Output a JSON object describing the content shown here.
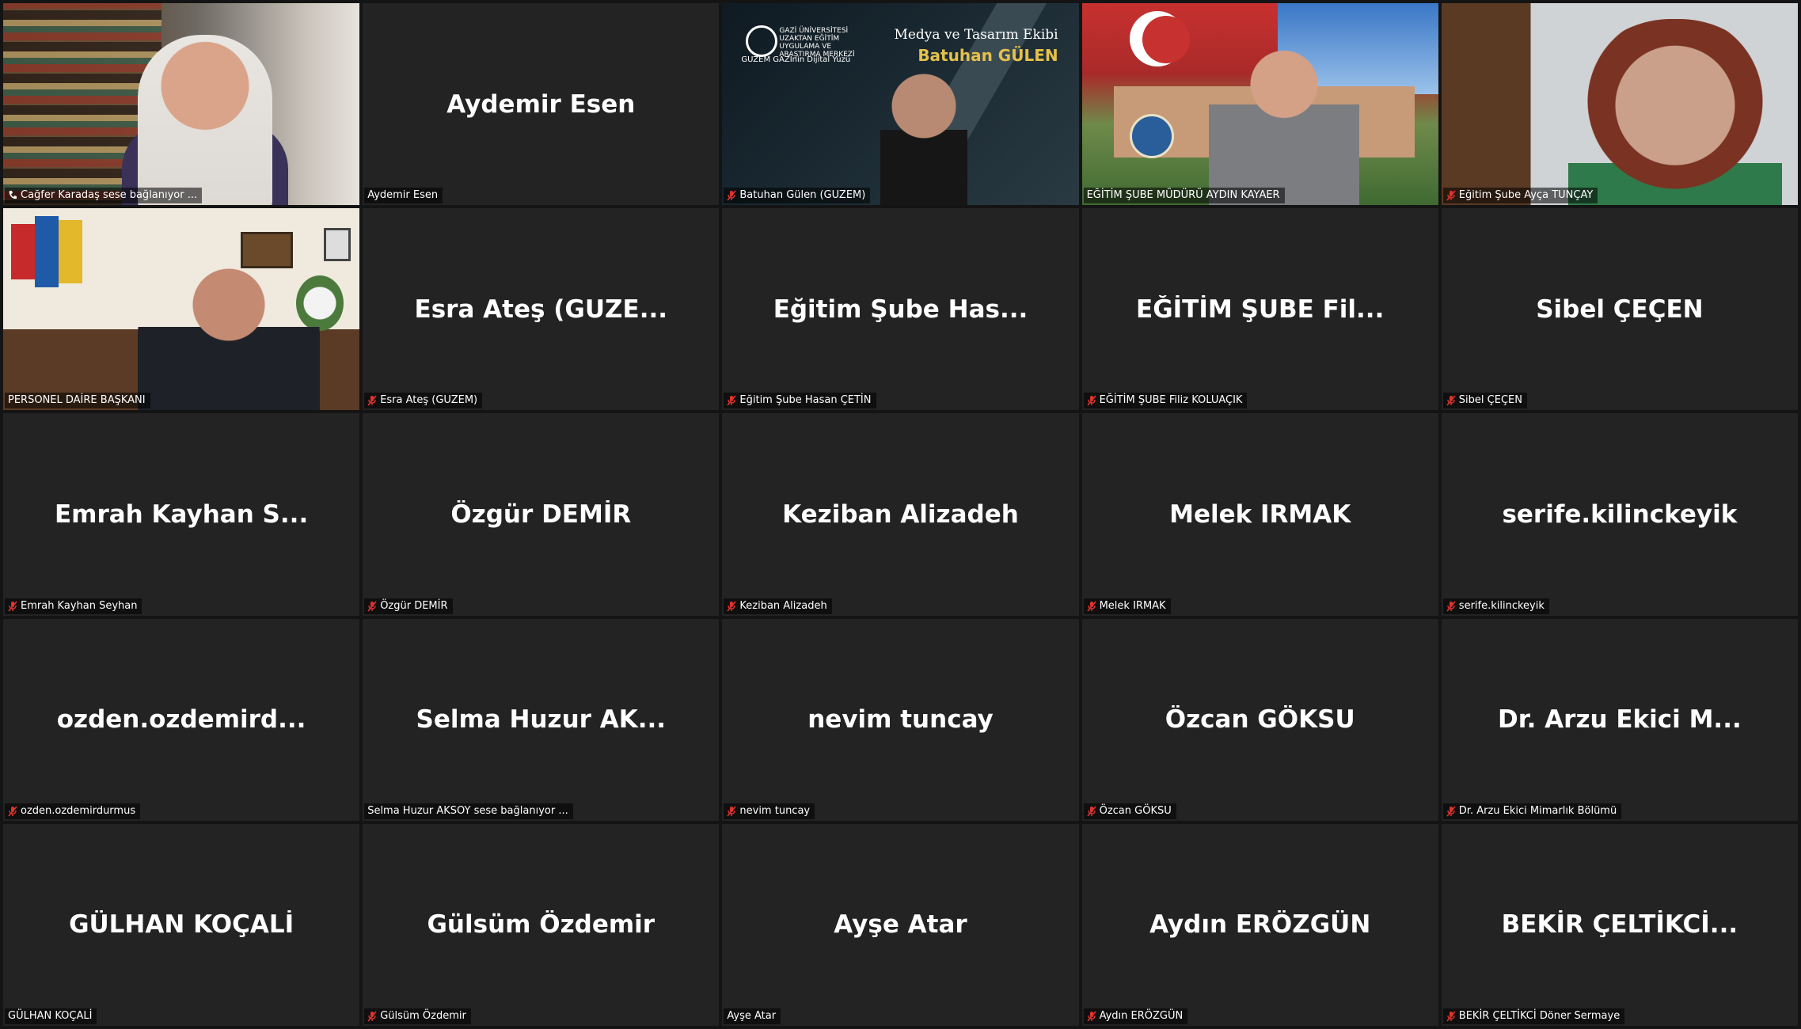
{
  "tiles": [
    {
      "id": "t1",
      "display_name": "",
      "label": "Cağfer Karadaş sese bağlanıyor ...",
      "video": true,
      "muted": false,
      "connecting": true,
      "active": true
    },
    {
      "id": "t2",
      "display_name": "Aydemir Esen",
      "label": "Aydemir Esen",
      "video": false,
      "muted": false
    },
    {
      "id": "t3",
      "display_name": "",
      "label": "Batuhan Gülen (GUZEM)",
      "video": true,
      "muted": true,
      "overlay": {
        "org": "GAZİ ÜNİVERSİTESİ UZAKTAN EĞİTİM UYGULAMA VE ARAŞTIRMA MERKEZİ",
        "brand": "GUZEM GAZİnin Dijital Yüzü",
        "title": "Medya ve Tasarım Ekibi",
        "subtitle": "Batuhan GÜLEN"
      }
    },
    {
      "id": "t4",
      "display_name": "",
      "label": "EĞİTİM ŞUBE MÜDÜRÜ AYDIN KAYAER",
      "video": true,
      "muted": false
    },
    {
      "id": "t5",
      "display_name": "",
      "label": "Eğitim Şube Ayça TUNÇAY",
      "video": true,
      "muted": true
    },
    {
      "id": "t6",
      "display_name": "",
      "label": "PERSONEL DAİRE BAŞKANI",
      "video": true,
      "muted": false
    },
    {
      "id": "t7",
      "display_name": "Esra Ateş (GUZE...",
      "label": "Esra Ateş (GUZEM)",
      "video": false,
      "muted": true
    },
    {
      "id": "t8",
      "display_name": "Eğitim Şube Has...",
      "label": "Eğitim Şube Hasan ÇETİN",
      "video": false,
      "muted": true
    },
    {
      "id": "t9",
      "display_name": "EĞİTİM ŞUBE Fil...",
      "label": "EĞİTİM ŞUBE Filiz KOLUAÇIK",
      "video": false,
      "muted": true
    },
    {
      "id": "t10",
      "display_name": "Sibel ÇEÇEN",
      "label": "Sibel ÇEÇEN",
      "video": false,
      "muted": true
    },
    {
      "id": "t11",
      "display_name": "Emrah Kayhan S...",
      "label": "Emrah Kayhan Seyhan",
      "video": false,
      "muted": true
    },
    {
      "id": "t12",
      "display_name": "Özgür DEMİR",
      "label": "Özgür DEMİR",
      "video": false,
      "muted": true
    },
    {
      "id": "t13",
      "display_name": "Keziban Alizadeh",
      "label": "Keziban Alizadeh",
      "video": false,
      "muted": true
    },
    {
      "id": "t14",
      "display_name": "Melek IRMAK",
      "label": "Melek IRMAK",
      "video": false,
      "muted": true
    },
    {
      "id": "t15",
      "display_name": "serife.kilinckeyik",
      "label": "serife.kilinckeyik",
      "video": false,
      "muted": true
    },
    {
      "id": "t16",
      "display_name": "ozden.ozdemird...",
      "label": "ozden.ozdemirdurmus",
      "video": false,
      "muted": true
    },
    {
      "id": "t17",
      "display_name": "Selma Huzur AK...",
      "label": "Selma Huzur AKSOY sese bağlanıyor ...",
      "video": false,
      "muted": false
    },
    {
      "id": "t18",
      "display_name": "nevim tuncay",
      "label": "nevim tuncay",
      "video": false,
      "muted": true
    },
    {
      "id": "t19",
      "display_name": "Özcan GÖKSU",
      "label": "Özcan GÖKSU",
      "video": false,
      "muted": true
    },
    {
      "id": "t20",
      "display_name": "Dr. Arzu Ekici M...",
      "label": "Dr. Arzu Ekici Mimarlık Bölümü",
      "video": false,
      "muted": true
    },
    {
      "id": "t21",
      "display_name": "GÜLHAN KOÇALİ",
      "label": "GÜLHAN KOÇALİ",
      "video": false,
      "muted": false
    },
    {
      "id": "t22",
      "display_name": "Gülsüm Özdemir",
      "label": "Gülsüm Özdemir",
      "video": false,
      "muted": true
    },
    {
      "id": "t23",
      "display_name": "Ayşe Atar",
      "label": "Ayşe Atar",
      "video": false,
      "muted": false
    },
    {
      "id": "t24",
      "display_name": "Aydın ERÖZGÜN",
      "label": "Aydın ERÖZGÜN",
      "video": false,
      "muted": true
    },
    {
      "id": "t25",
      "display_name": "BEKİR ÇELTİKCİ...",
      "label": "BEKİR ÇELTİKCİ Döner Sermaye",
      "video": false,
      "muted": true
    }
  ],
  "colors": {
    "tile_bg": "#232323",
    "page_bg": "#141414",
    "active_speaker_border": "#c3d94a",
    "mute_icon": "#e0332f"
  },
  "icons": {
    "muted": "microphone-muted-icon",
    "connecting": "phone-connecting-icon"
  }
}
